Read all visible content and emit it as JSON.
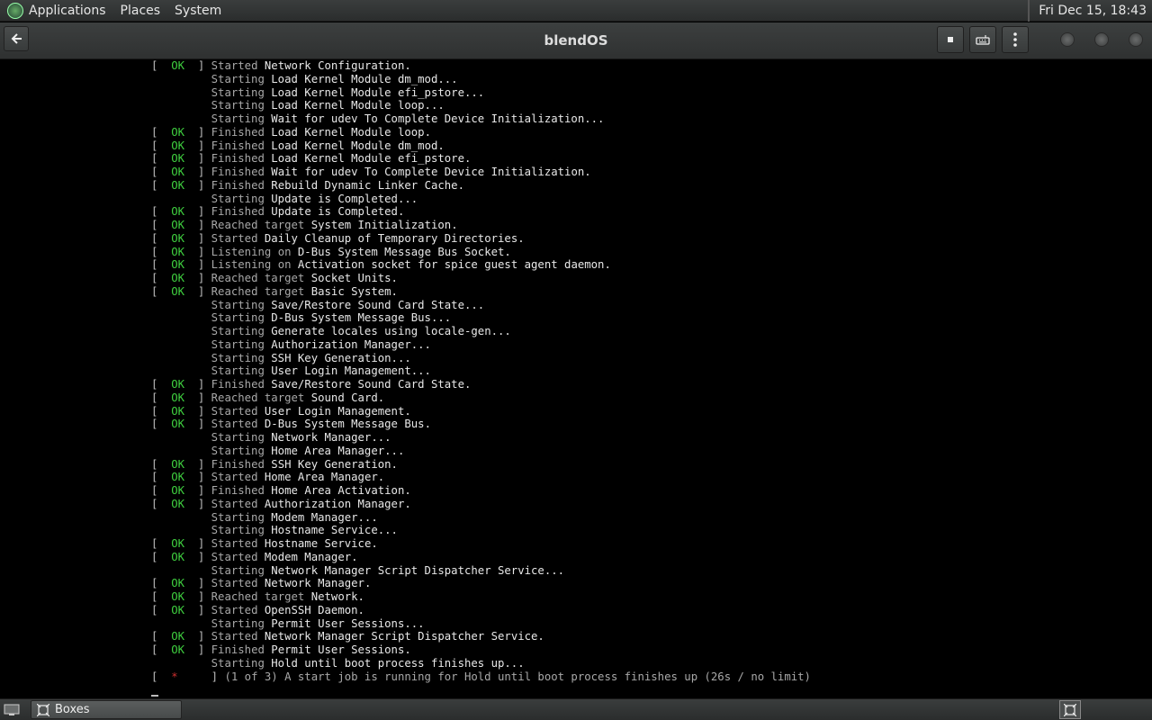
{
  "top_panel": {
    "menus": [
      "Applications",
      "Places",
      "System"
    ],
    "clock": "Fri Dec 15, 18:43"
  },
  "window": {
    "title": "blendOS"
  },
  "taskbar": {
    "app_label": "Boxes"
  },
  "console": {
    "lines": [
      {
        "status": "OK",
        "verb": "Started",
        "text": "Network Configuration."
      },
      {
        "status": "",
        "verb": "Starting",
        "text": "Load Kernel Module dm_mod..."
      },
      {
        "status": "",
        "verb": "Starting",
        "text": "Load Kernel Module efi_pstore..."
      },
      {
        "status": "",
        "verb": "Starting",
        "text": "Load Kernel Module loop..."
      },
      {
        "status": "",
        "verb": "Starting",
        "text": "Wait for udev To Complete Device Initialization..."
      },
      {
        "status": "OK",
        "verb": "Finished",
        "text": "Load Kernel Module loop."
      },
      {
        "status": "OK",
        "verb": "Finished",
        "text": "Load Kernel Module dm_mod."
      },
      {
        "status": "OK",
        "verb": "Finished",
        "text": "Load Kernel Module efi_pstore."
      },
      {
        "status": "OK",
        "verb": "Finished",
        "text": "Wait for udev To Complete Device Initialization."
      },
      {
        "status": "OK",
        "verb": "Finished",
        "text": "Rebuild Dynamic Linker Cache."
      },
      {
        "status": "",
        "verb": "Starting",
        "text": "Update is Completed..."
      },
      {
        "status": "OK",
        "verb": "Finished",
        "text": "Update is Completed."
      },
      {
        "status": "OK",
        "verb": "Reached target",
        "text": "System Initialization."
      },
      {
        "status": "OK",
        "verb": "Started",
        "text": "Daily Cleanup of Temporary Directories."
      },
      {
        "status": "OK",
        "verb": "Listening on",
        "text": "D-Bus System Message Bus Socket."
      },
      {
        "status": "OK",
        "verb": "Listening on",
        "text": "Activation socket for spice guest agent daemon."
      },
      {
        "status": "OK",
        "verb": "Reached target",
        "text": "Socket Units."
      },
      {
        "status": "OK",
        "verb": "Reached target",
        "text": "Basic System."
      },
      {
        "status": "",
        "verb": "Starting",
        "text": "Save/Restore Sound Card State..."
      },
      {
        "status": "",
        "verb": "Starting",
        "text": "D-Bus System Message Bus..."
      },
      {
        "status": "",
        "verb": "Starting",
        "text": "Generate locales using locale-gen..."
      },
      {
        "status": "",
        "verb": "Starting",
        "text": "Authorization Manager..."
      },
      {
        "status": "",
        "verb": "Starting",
        "text": "SSH Key Generation..."
      },
      {
        "status": "",
        "verb": "Starting",
        "text": "User Login Management..."
      },
      {
        "status": "OK",
        "verb": "Finished",
        "text": "Save/Restore Sound Card State."
      },
      {
        "status": "OK",
        "verb": "Reached target",
        "text": "Sound Card."
      },
      {
        "status": "OK",
        "verb": "Started",
        "text": "User Login Management."
      },
      {
        "status": "OK",
        "verb": "Started",
        "text": "D-Bus System Message Bus."
      },
      {
        "status": "",
        "verb": "Starting",
        "text": "Network Manager..."
      },
      {
        "status": "",
        "verb": "Starting",
        "text": "Home Area Manager..."
      },
      {
        "status": "OK",
        "verb": "Finished",
        "text": "SSH Key Generation."
      },
      {
        "status": "OK",
        "verb": "Started",
        "text": "Home Area Manager."
      },
      {
        "status": "OK",
        "verb": "Finished",
        "text": "Home Area Activation."
      },
      {
        "status": "OK",
        "verb": "Started",
        "text": "Authorization Manager."
      },
      {
        "status": "",
        "verb": "Starting",
        "text": "Modem Manager..."
      },
      {
        "status": "",
        "verb": "Starting",
        "text": "Hostname Service..."
      },
      {
        "status": "OK",
        "verb": "Started",
        "text": "Hostname Service."
      },
      {
        "status": "OK",
        "verb": "Started",
        "text": "Modem Manager."
      },
      {
        "status": "",
        "verb": "Starting",
        "text": "Network Manager Script Dispatcher Service..."
      },
      {
        "status": "OK",
        "verb": "Started",
        "text": "Network Manager."
      },
      {
        "status": "OK",
        "verb": "Reached target",
        "text": "Network."
      },
      {
        "status": "OK",
        "verb": "Started",
        "text": "OpenSSH Daemon."
      },
      {
        "status": "",
        "verb": "Starting",
        "text": "Permit User Sessions..."
      },
      {
        "status": "OK",
        "verb": "Started",
        "text": "Network Manager Script Dispatcher Service."
      },
      {
        "status": "OK",
        "verb": "Finished",
        "text": "Permit User Sessions."
      },
      {
        "status": "",
        "verb": "Starting",
        "text": "Hold until boot process finishes up..."
      },
      {
        "status": "*",
        "verb": "",
        "text": "(1 of 3) A start job is running for Hold until boot process finishes up (26s / no limit)"
      }
    ]
  }
}
